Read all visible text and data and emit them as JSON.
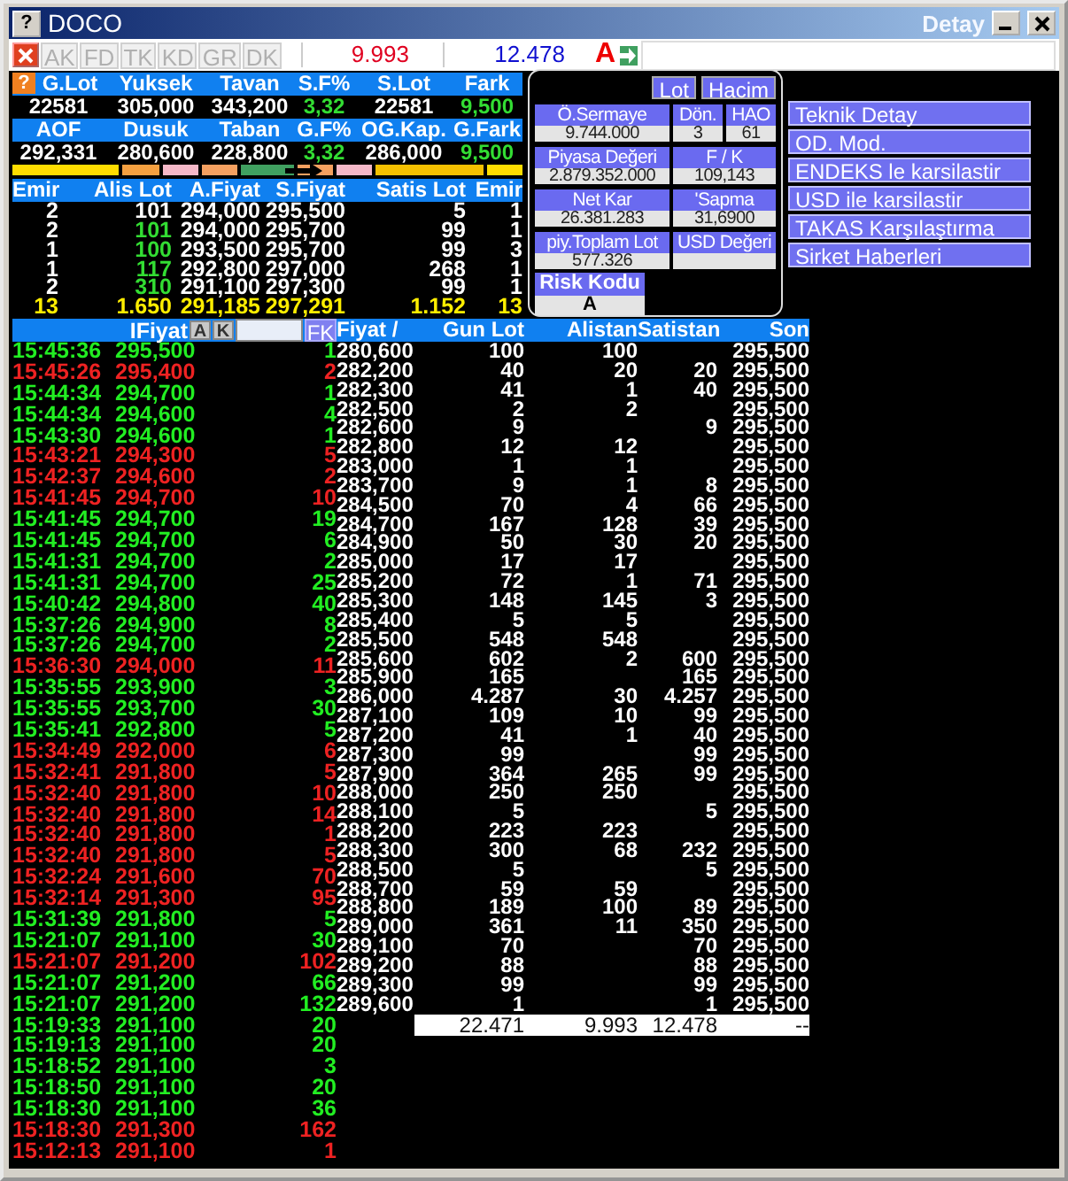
{
  "window": {
    "title": "DOCO",
    "subtitle": "Detay",
    "help": "?"
  },
  "summary_help": "?",
  "toolbar": {
    "tabs": [
      "AK",
      "FD",
      "TK",
      "KD",
      "GR",
      "DK"
    ],
    "sell_total": "9.993",
    "buy_total": "12.478",
    "risk": "A"
  },
  "summary": [
    {
      "label": "G.Lot",
      "value": "22581",
      "color": "#ffffff"
    },
    {
      "label": "Yuksek",
      "value": "305,000",
      "color": "#ffffff"
    },
    {
      "label": "Tavan",
      "value": "343,200",
      "color": "#ffffff"
    },
    {
      "label": "S.F%",
      "value": "3,32",
      "color": "#33dd33"
    },
    {
      "label": "S.Lot",
      "value": "22581",
      "color": "#ffffff"
    },
    {
      "label": "Fark",
      "value": "9,500",
      "color": "#33dd33"
    },
    {
      "label": "AOF",
      "value": "292,331",
      "color": "#ffffff"
    },
    {
      "label": "Dusuk",
      "value": "280,600",
      "color": "#ffffff"
    },
    {
      "label": "Taban",
      "value": "228,800",
      "color": "#ffffff"
    },
    {
      "label": "G.F%",
      "value": "3,32",
      "color": "#33dd33"
    },
    {
      "label": "OG.Kap.",
      "value": "286,000",
      "color": "#ffffff"
    },
    {
      "label": "G.Fark",
      "value": "9,500",
      "color": "#33dd33"
    }
  ],
  "range_bar": [
    {
      "color": "#ffdd00"
    },
    {
      "color": "#f5a040"
    },
    {
      "color": "#f5b8c8"
    },
    {
      "color": "#f5a060"
    },
    {
      "color": "#40a060"
    },
    {
      "color": "#f5a060"
    },
    {
      "color": "#f5b8c8"
    },
    {
      "color": "#f5c000"
    },
    {
      "color": "#ffdd00"
    }
  ],
  "depth": {
    "columns": [
      "Emir",
      "Alis Lot",
      "A.Fiyat",
      "S.Fiyat",
      "Satis Lot",
      "Emir"
    ],
    "rows": [
      {
        "bid_orders": "2",
        "bid_lot": "101",
        "bid": "294,000",
        "ask": "295,500",
        "ask_lot": "5",
        "ask_orders": "1",
        "color": "#ffffff"
      },
      {
        "bid_orders": "2",
        "bid_lot": "101",
        "bid": "294,000",
        "ask": "295,700",
        "ask_lot": "99",
        "ask_orders": "1",
        "color": "#33dd33"
      },
      {
        "bid_orders": "1",
        "bid_lot": "100",
        "bid": "293,500",
        "ask": "295,700",
        "ask_lot": "99",
        "ask_orders": "3",
        "color": "#33dd33"
      },
      {
        "bid_orders": "1",
        "bid_lot": "117",
        "bid": "292,800",
        "ask": "297,000",
        "ask_lot": "268",
        "ask_orders": "1",
        "color": "#33dd33"
      },
      {
        "bid_orders": "2",
        "bid_lot": "310",
        "bid": "291,100",
        "ask": "297,300",
        "ask_lot": "99",
        "ask_orders": "1",
        "color": "#33dd33"
      }
    ],
    "total": {
      "bid_orders": "13",
      "bid_lot": "1.650",
      "bid": "291,185",
      "ask": "297,291",
      "ask_lot": "1.152",
      "ask_orders": "13"
    }
  },
  "info": {
    "toggles": [
      "Lot",
      "Hacim"
    ],
    "rows": [
      [
        {
          "label": "Ö.Sermaye",
          "value": "9.744.000"
        },
        {
          "label": "Dön.",
          "value": "3"
        },
        {
          "label": "HAO",
          "value": "61"
        }
      ],
      [
        {
          "label": "Piyasa Değeri",
          "value": "2.879.352.000"
        },
        {
          "label": "F / K",
          "value": "109,143"
        }
      ],
      [
        {
          "label": "Net Kar",
          "value": "26.381.283"
        },
        {
          "label": "'Sapma",
          "value": "31,6900"
        }
      ],
      [
        {
          "label": "piy.Toplam Lot",
          "value": "577.326"
        },
        {
          "label": "USD Değeri"
        }
      ]
    ],
    "risk": {
      "label": "Risk Kodu",
      "value": "A"
    }
  },
  "links": [
    "Teknik Detay",
    "OD. Mod.",
    "ENDEKS le karsilastir",
    "USD ile karsilastir",
    "TAKAS Karşılaştırma",
    "Sirket Haberleri"
  ],
  "trades": {
    "header": "IFiyat",
    "buttons": [
      "A",
      "K"
    ],
    "filter": "FK",
    "rows": [
      {
        "time": "15:45:36",
        "price": "295,500",
        "lot": "1",
        "color": "#22ee22"
      },
      {
        "time": "15:45:26",
        "price": "295,400",
        "lot": "2",
        "color": "#ee2222"
      },
      {
        "time": "15:44:34",
        "price": "294,700",
        "lot": "1",
        "color": "#22ee22"
      },
      {
        "time": "15:44:34",
        "price": "294,600",
        "lot": "4",
        "color": "#22ee22"
      },
      {
        "time": "15:43:30",
        "price": "294,600",
        "lot": "1",
        "color": "#22ee22"
      },
      {
        "time": "15:43:21",
        "price": "294,300",
        "lot": "5",
        "color": "#ee2222"
      },
      {
        "time": "15:42:37",
        "price": "294,600",
        "lot": "2",
        "color": "#ee2222"
      },
      {
        "time": "15:41:45",
        "price": "294,700",
        "lot": "10",
        "color": "#ee2222"
      },
      {
        "time": "15:41:45",
        "price": "294,700",
        "lot": "19",
        "color": "#22ee22"
      },
      {
        "time": "15:41:45",
        "price": "294,700",
        "lot": "6",
        "color": "#22ee22"
      },
      {
        "time": "15:41:31",
        "price": "294,700",
        "lot": "2",
        "color": "#22ee22"
      },
      {
        "time": "15:41:31",
        "price": "294,700",
        "lot": "25",
        "color": "#22ee22"
      },
      {
        "time": "15:40:42",
        "price": "294,800",
        "lot": "40",
        "color": "#22ee22"
      },
      {
        "time": "15:37:26",
        "price": "294,900",
        "lot": "8",
        "color": "#22ee22"
      },
      {
        "time": "15:37:26",
        "price": "294,700",
        "lot": "2",
        "color": "#22ee22"
      },
      {
        "time": "15:36:30",
        "price": "294,000",
        "lot": "11",
        "color": "#ee2222"
      },
      {
        "time": "15:35:55",
        "price": "293,900",
        "lot": "3",
        "color": "#22ee22"
      },
      {
        "time": "15:35:55",
        "price": "293,700",
        "lot": "30",
        "color": "#22ee22"
      },
      {
        "time": "15:35:41",
        "price": "292,800",
        "lot": "5",
        "color": "#22ee22"
      },
      {
        "time": "15:34:49",
        "price": "292,000",
        "lot": "6",
        "color": "#ee2222"
      },
      {
        "time": "15:32:41",
        "price": "291,800",
        "lot": "5",
        "color": "#ee2222"
      },
      {
        "time": "15:32:40",
        "price": "291,800",
        "lot": "10",
        "color": "#ee2222"
      },
      {
        "time": "15:32:40",
        "price": "291,800",
        "lot": "14",
        "color": "#ee2222"
      },
      {
        "time": "15:32:40",
        "price": "291,800",
        "lot": "1",
        "color": "#ee2222"
      },
      {
        "time": "15:32:40",
        "price": "291,800",
        "lot": "5",
        "color": "#ee2222"
      },
      {
        "time": "15:32:24",
        "price": "291,600",
        "lot": "70",
        "color": "#ee2222"
      },
      {
        "time": "15:32:14",
        "price": "291,300",
        "lot": "95",
        "color": "#ee2222"
      },
      {
        "time": "15:31:39",
        "price": "291,800",
        "lot": "5",
        "color": "#22ee22"
      },
      {
        "time": "15:21:07",
        "price": "291,100",
        "lot": "30",
        "color": "#22ee22"
      },
      {
        "time": "15:21:07",
        "price": "291,200",
        "lot": "102",
        "color": "#ee2222"
      },
      {
        "time": "15:21:07",
        "price": "291,200",
        "lot": "66",
        "color": "#22ee22"
      },
      {
        "time": "15:21:07",
        "price": "291,200",
        "lot": "132",
        "color": "#22ee22"
      },
      {
        "time": "15:19:33",
        "price": "291,100",
        "lot": "20",
        "color": "#22ee22"
      },
      {
        "time": "15:19:13",
        "price": "291,100",
        "lot": "20",
        "color": "#22ee22"
      },
      {
        "time": "15:18:52",
        "price": "291,100",
        "lot": "3",
        "color": "#22ee22"
      },
      {
        "time": "15:18:50",
        "price": "291,100",
        "lot": "20",
        "color": "#22ee22"
      },
      {
        "time": "15:18:30",
        "price": "291,100",
        "lot": "36",
        "color": "#22ee22"
      },
      {
        "time": "15:18:30",
        "price": "291,300",
        "lot": "162",
        "color": "#ee2222"
      },
      {
        "time": "15:12:13",
        "price": "291,100",
        "lot": "1",
        "color": "#ee2222"
      }
    ]
  },
  "price_table": {
    "columns": [
      "Fiyat /",
      "Gun Lot",
      "Alistan",
      "Satistan",
      "Son"
    ],
    "rows": [
      {
        "price": "280,600",
        "day_lot": "100",
        "bought": "100",
        "last": "295,500"
      },
      {
        "price": "282,200",
        "day_lot": "40",
        "bought": "20",
        "sold": "20",
        "last": "295,500"
      },
      {
        "price": "282,300",
        "day_lot": "41",
        "bought": "1",
        "sold": "40",
        "last": "295,500"
      },
      {
        "price": "282,500",
        "day_lot": "2",
        "bought": "2",
        "last": "295,500"
      },
      {
        "price": "282,600",
        "day_lot": "9",
        "sold": "9",
        "last": "295,500"
      },
      {
        "price": "282,800",
        "day_lot": "12",
        "bought": "12",
        "last": "295,500"
      },
      {
        "price": "283,000",
        "day_lot": "1",
        "bought": "1",
        "last": "295,500"
      },
      {
        "price": "283,700",
        "day_lot": "9",
        "bought": "1",
        "sold": "8",
        "last": "295,500"
      },
      {
        "price": "284,500",
        "day_lot": "70",
        "bought": "4",
        "sold": "66",
        "last": "295,500"
      },
      {
        "price": "284,700",
        "day_lot": "167",
        "bought": "128",
        "sold": "39",
        "last": "295,500"
      },
      {
        "price": "284,900",
        "day_lot": "50",
        "bought": "30",
        "sold": "20",
        "last": "295,500"
      },
      {
        "price": "285,000",
        "day_lot": "17",
        "bought": "17",
        "last": "295,500"
      },
      {
        "price": "285,200",
        "day_lot": "72",
        "bought": "1",
        "sold": "71",
        "last": "295,500"
      },
      {
        "price": "285,300",
        "day_lot": "148",
        "bought": "145",
        "sold": "3",
        "last": "295,500"
      },
      {
        "price": "285,400",
        "day_lot": "5",
        "bought": "5",
        "last": "295,500"
      },
      {
        "price": "285,500",
        "day_lot": "548",
        "bought": "548",
        "last": "295,500"
      },
      {
        "price": "285,600",
        "day_lot": "602",
        "bought": "2",
        "sold": "600",
        "last": "295,500"
      },
      {
        "price": "285,900",
        "day_lot": "165",
        "sold": "165",
        "last": "295,500"
      },
      {
        "price": "286,000",
        "day_lot": "4.287",
        "bought": "30",
        "sold": "4.257",
        "last": "295,500"
      },
      {
        "price": "287,100",
        "day_lot": "109",
        "bought": "10",
        "sold": "99",
        "last": "295,500"
      },
      {
        "price": "287,200",
        "day_lot": "41",
        "bought": "1",
        "sold": "40",
        "last": "295,500"
      },
      {
        "price": "287,300",
        "day_lot": "99",
        "sold": "99",
        "last": "295,500"
      },
      {
        "price": "287,900",
        "day_lot": "364",
        "bought": "265",
        "sold": "99",
        "last": "295,500"
      },
      {
        "price": "288,000",
        "day_lot": "250",
        "bought": "250",
        "last": "295,500"
      },
      {
        "price": "288,100",
        "day_lot": "5",
        "sold": "5",
        "last": "295,500"
      },
      {
        "price": "288,200",
        "day_lot": "223",
        "bought": "223",
        "last": "295,500"
      },
      {
        "price": "288,300",
        "day_lot": "300",
        "bought": "68",
        "sold": "232",
        "last": "295,500"
      },
      {
        "price": "288,500",
        "day_lot": "5",
        "sold": "5",
        "last": "295,500"
      },
      {
        "price": "288,700",
        "day_lot": "59",
        "bought": "59",
        "last": "295,500"
      },
      {
        "price": "288,800",
        "day_lot": "189",
        "bought": "100",
        "sold": "89",
        "last": "295,500"
      },
      {
        "price": "289,000",
        "day_lot": "361",
        "bought": "11",
        "sold": "350",
        "last": "295,500"
      },
      {
        "price": "289,100",
        "day_lot": "70",
        "sold": "70",
        "last": "295,500"
      },
      {
        "price": "289,200",
        "day_lot": "88",
        "sold": "88",
        "last": "295,500"
      },
      {
        "price": "289,300",
        "day_lot": "99",
        "sold": "99",
        "last": "295,500"
      },
      {
        "price": "289,600",
        "day_lot": "1",
        "sold": "1",
        "last": "295,500"
      }
    ],
    "total": {
      "day_lot": "22.471",
      "bought": "9.993",
      "sold": "12.478",
      "last": "--"
    }
  }
}
